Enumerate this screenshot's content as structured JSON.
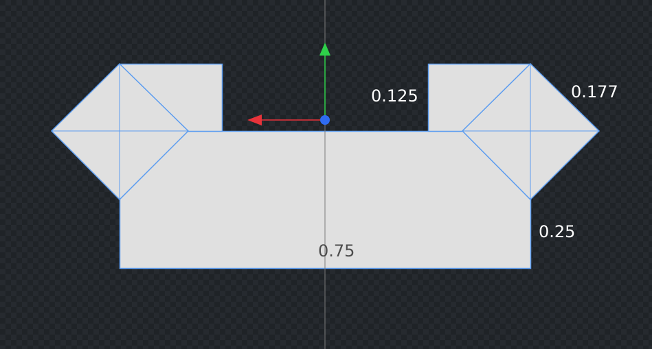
{
  "colors": {
    "background": "#1f2327",
    "checker": "#262a2f",
    "shape_fill": "#e0e0e0",
    "shape_edge": "#5b9cf0",
    "axis_line": "#7a7a7a",
    "gizmo_x": "#e8333a",
    "gizmo_y": "#2ed04a",
    "gizmo_origin": "#2f6bf0",
    "label_outside": "#ffffff",
    "label_inside": "#4d4d4d"
  },
  "dimensions": {
    "top_gap": "0.125",
    "diagonal": "0.177",
    "side_height": "0.25",
    "base_width": "0.75"
  },
  "gizmo": {
    "x_axis_icon": "red-arrow-icon",
    "y_axis_icon": "green-arrow-icon",
    "origin_icon": "blue-dot-icon"
  }
}
